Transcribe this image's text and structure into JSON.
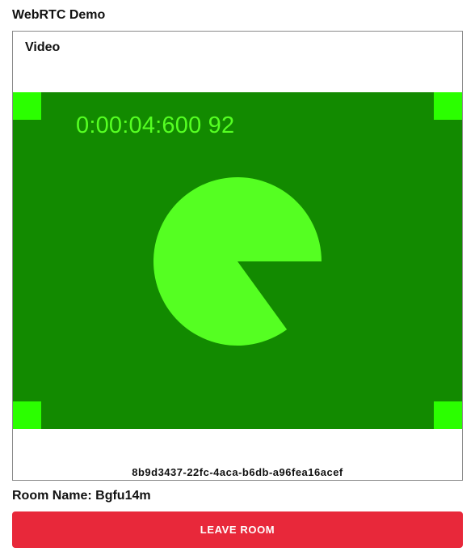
{
  "app": {
    "title": "WebRTC Demo"
  },
  "video_panel": {
    "heading": "Video",
    "stream": {
      "timestamp_text": "0:00:04:600 92",
      "pie_fraction_filled": 0.85,
      "colors": {
        "background": "#128a00",
        "foreground": "#55ff22",
        "corner_markers": "#2bff00"
      }
    },
    "peer_id": "8b9d3437-22fc-4aca-b6db-a96fea16acef"
  },
  "room": {
    "label": "Room Name:",
    "name": "Bgfu14m"
  },
  "leave_button": {
    "label": "LEAVE ROOM",
    "color": "#e8283a"
  }
}
